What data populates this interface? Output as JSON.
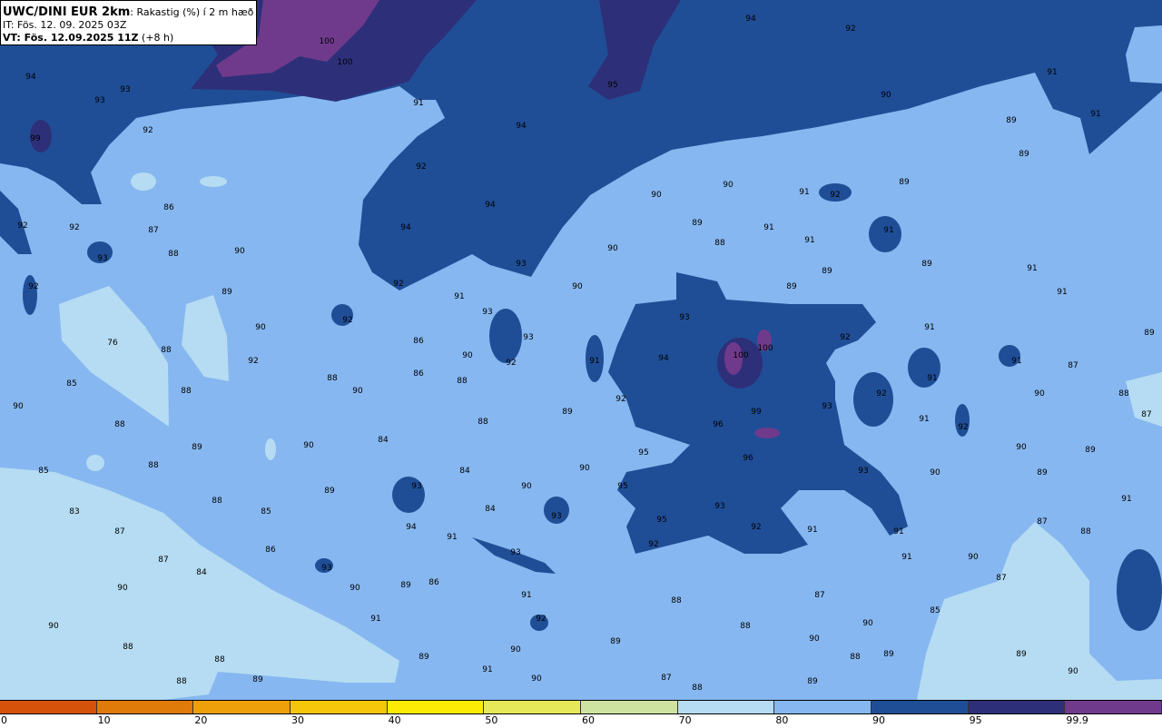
{
  "title": {
    "model": "UWC/DINI EUR 2km",
    "parameter": ": Rakastig (%) í 2 m hæð",
    "init_time": "IT: Fös. 12. 09. 2025 03Z",
    "valid_prefix": "VT: Fös. 12.09.2025 11Z",
    "lead": " (+8 h)"
  },
  "colorbar": {
    "colors": [
      "#d4520a",
      "#e07a08",
      "#eda00a",
      "#f5c60a",
      "#fbeb05",
      "#e6e85a",
      "#cfe3a0",
      "#b5dcf2",
      "#86b7f0",
      "#1f4e96",
      "#2d3079",
      "#703a8c"
    ],
    "tick_labels": [
      "0",
      "10",
      "20",
      "30",
      "40",
      "50",
      "60",
      "70",
      "80",
      "90",
      "95",
      "99.9"
    ]
  },
  "contour_labels": [
    "94",
    "92",
    "100",
    "100",
    "95",
    "91",
    "90",
    "91",
    "89",
    "89",
    "94",
    "93",
    "93",
    "91",
    "94",
    "92",
    "99",
    "92",
    "90",
    "90",
    "91",
    "92",
    "89",
    "86",
    "94",
    "94",
    "92",
    "92",
    "87",
    "89",
    "91",
    "88",
    "91",
    "91",
    "90",
    "88",
    "93",
    "90",
    "93",
    "89",
    "89",
    "92",
    "92",
    "91",
    "90",
    "89",
    "89",
    "91",
    "91",
    "93",
    "92",
    "93",
    "90",
    "91",
    "93",
    "86",
    "76",
    "92",
    "100",
    "88",
    "90",
    "94",
    "100",
    "91",
    "92",
    "92",
    "91",
    "89",
    "86",
    "88",
    "88",
    "91",
    "87",
    "85",
    "90",
    "88",
    "92",
    "92",
    "90",
    "88",
    "90",
    "93",
    "89",
    "99",
    "87",
    "91",
    "92",
    "96",
    "88",
    "88",
    "84",
    "90",
    "89",
    "90",
    "89",
    "95",
    "96",
    "85",
    "88",
    "84",
    "90",
    "93",
    "90",
    "89",
    "93",
    "95",
    "90",
    "89",
    "88",
    "84",
    "85",
    "83",
    "93",
    "93",
    "91",
    "87",
    "94",
    "92",
    "91",
    "91",
    "95",
    "87",
    "88",
    "91",
    "93",
    "86",
    "92",
    "87",
    "91",
    "90",
    "93",
    "84",
    "87",
    "90",
    "90",
    "89",
    "86",
    "91",
    "87",
    "88",
    "91",
    "92",
    "85",
    "90",
    "88",
    "90",
    "89",
    "90",
    "88",
    "89",
    "88",
    "90",
    "89",
    "88",
    "89",
    "91",
    "90",
    "88",
    "89",
    "87",
    "88",
    "89",
    "90"
  ]
}
